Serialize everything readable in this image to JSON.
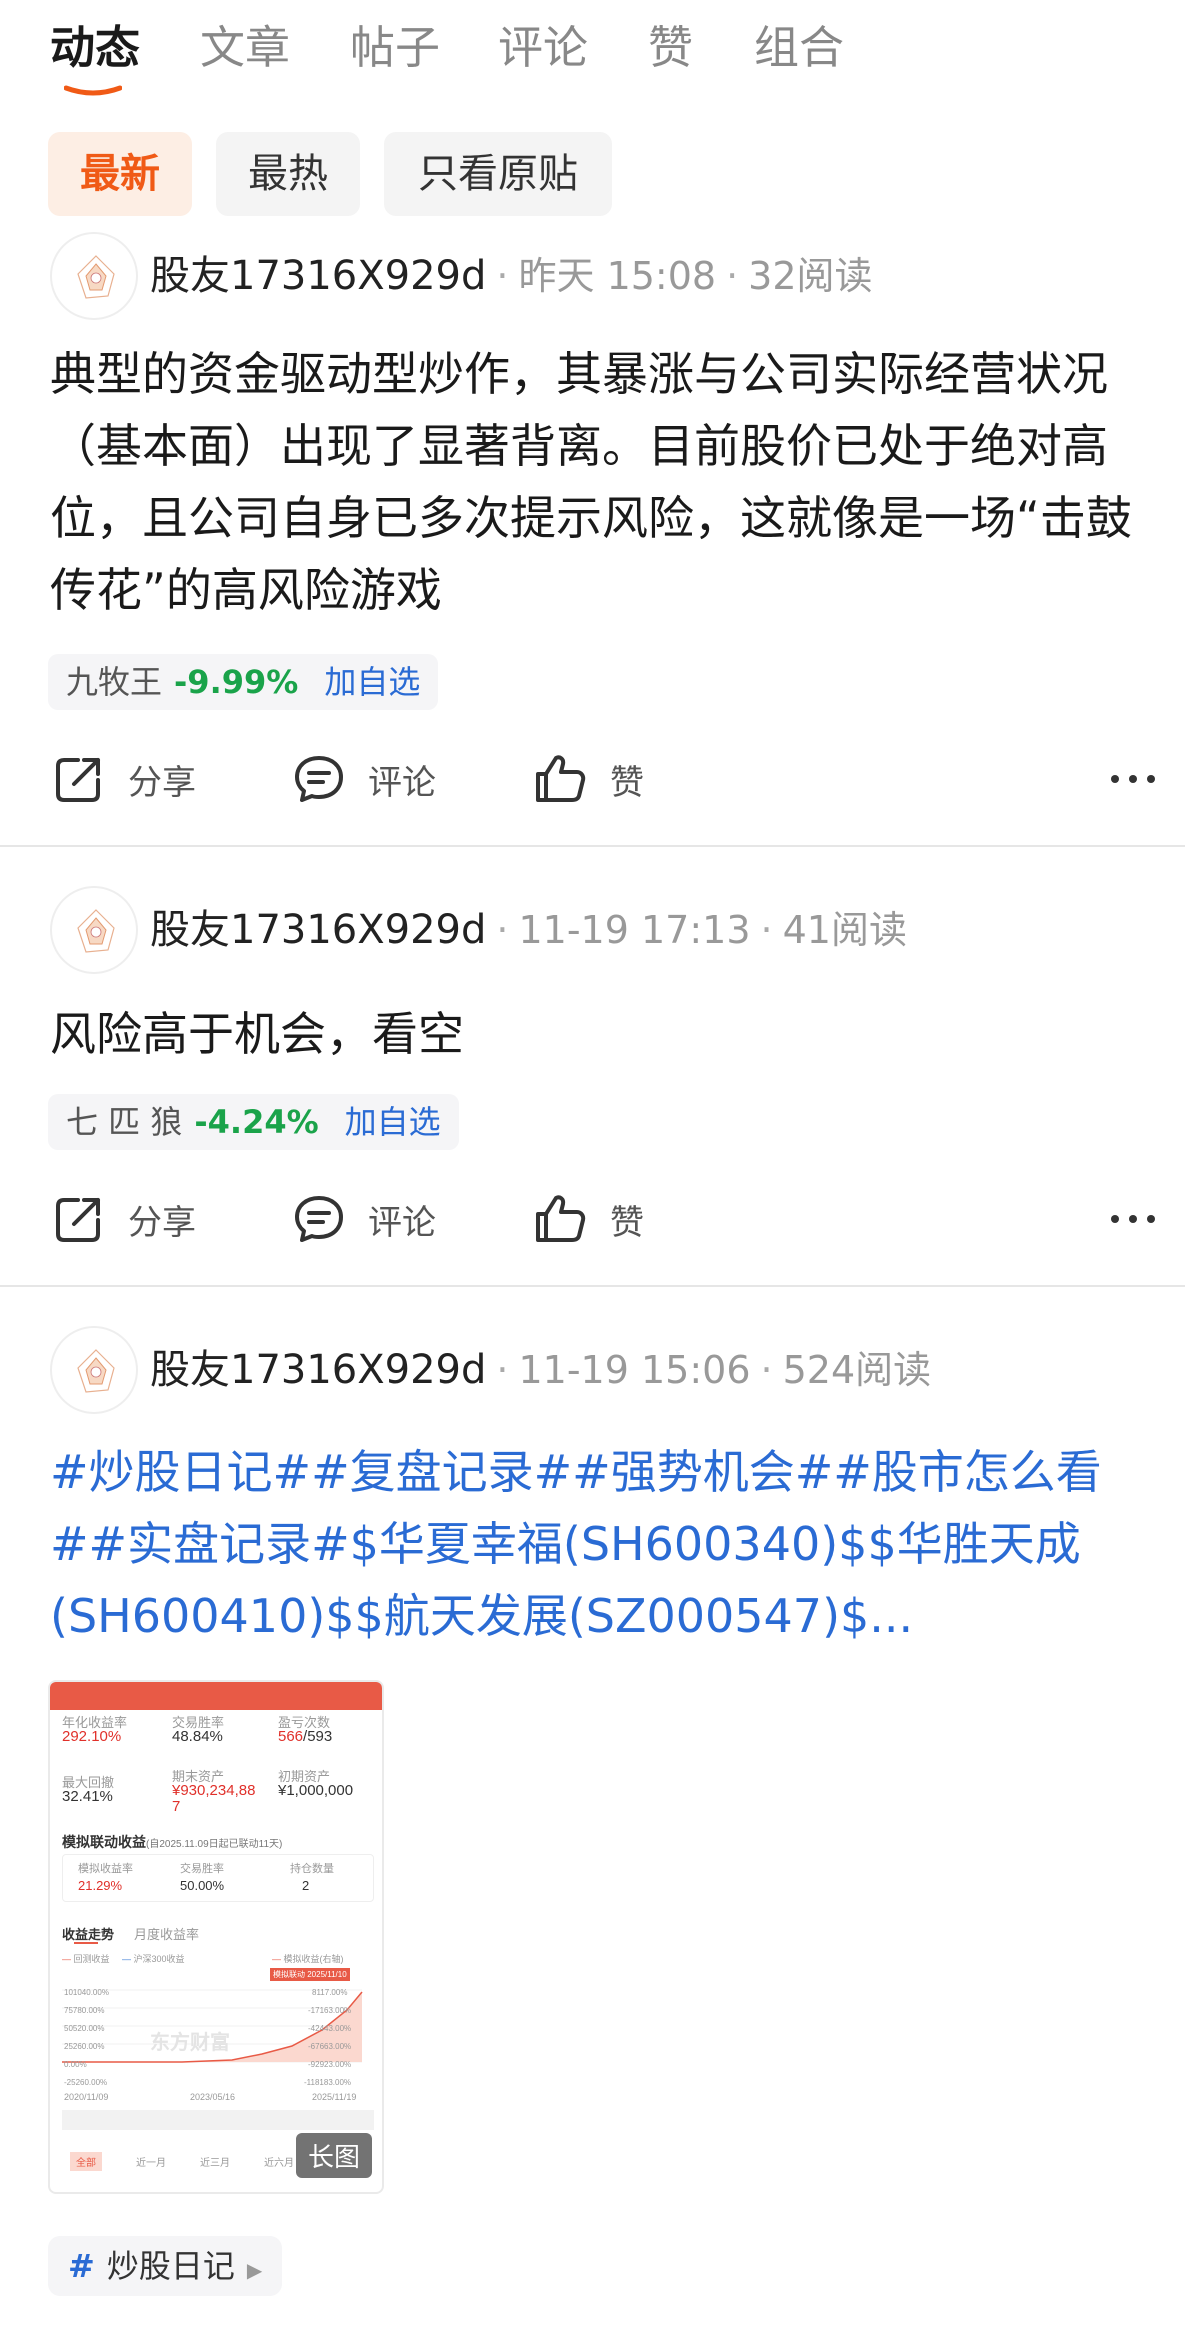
{
  "tabs": [
    "动态",
    "文章",
    "帖子",
    "评论",
    "赞",
    "组合"
  ],
  "accent": "#f05a16",
  "filters": [
    "最新",
    "最热",
    "只看原贴"
  ],
  "actions": {
    "share": "分享",
    "comment": "评论",
    "like": "赞"
  },
  "posts": [
    {
      "author": "股友17316X929d",
      "time": "昨天 15:08",
      "reads": "32阅读",
      "text": "典型的资金驱动型炒作，其暴涨与公司实际经营状况（基本面）出现了显著背离。目前股价已处于绝对高位，且公司自身已多次提示风险，这就像是一场“击鼓传花”的高风险游戏",
      "stock": {
        "name": "九牧王",
        "change": "-9.99%",
        "add": "加自选"
      }
    },
    {
      "author": "股友17316X929d",
      "time": "11-19 17:13",
      "reads": "41阅读",
      "text": "风险高于机会，看空",
      "stock": {
        "name": "七 匹 狼",
        "change": "-4.24%",
        "add": "加自选"
      }
    },
    {
      "author": "股友17316X929d",
      "time": "11-19 15:06",
      "reads": "524阅读",
      "text": "#炒股日记##复盘记录##强势机会##股市怎么看##实盘记录#$华夏幸福(SH600340)$$华胜天成(SH600410)$$航天发展(SZ000547)$...",
      "image_label": "长图",
      "tag": "炒股日记"
    }
  ],
  "thumb": {
    "annual_label": "年化收益率",
    "annual": "292.10%",
    "winrate_label": "交易胜率",
    "winrate": "48.84%",
    "pl_label": "盈亏次数",
    "pl_win": "566",
    "pl_total": "/593",
    "maxdd_label": "最大回撤",
    "maxdd": "32.41%",
    "end_label": "期末资产",
    "end": "¥930,234,88",
    "end2": "7",
    "init_label": "初期资产",
    "init": "¥1,000,000",
    "sim_title": "模拟联动收益",
    "sim_note": "(自2025.11.09日起已联动11天)",
    "sim_rate_label": "模拟收益率",
    "sim_rate": "21.29%",
    "trade_rate_label": "交易胜率",
    "trade_rate": "50.00%",
    "hold_label": "持仓数量",
    "hold": "2",
    "trend_tab": "收益走势",
    "month_tab": "月度收益率",
    "legend1": "回测收益",
    "legend2": "沪深300收益",
    "legend3": "模拟收益(右轴)",
    "badge": "模拟联动 2025/11/10",
    "ylabels": [
      "101040.00%",
      "75780.00%",
      "50520.00%",
      "25260.00%",
      "0.00%",
      "-25260.00%"
    ],
    "rlabels": [
      "8117.00%",
      "-17163.00%",
      "-42443.00%",
      "-67663.00%",
      "-92923.00%",
      "-118183.00%"
    ],
    "dates": [
      "2020/11/09",
      "2023/05/16",
      "2025/11/19"
    ],
    "watermark": "东方财富",
    "ranges": [
      "全部",
      "近一月",
      "近三月",
      "近六月"
    ]
  }
}
